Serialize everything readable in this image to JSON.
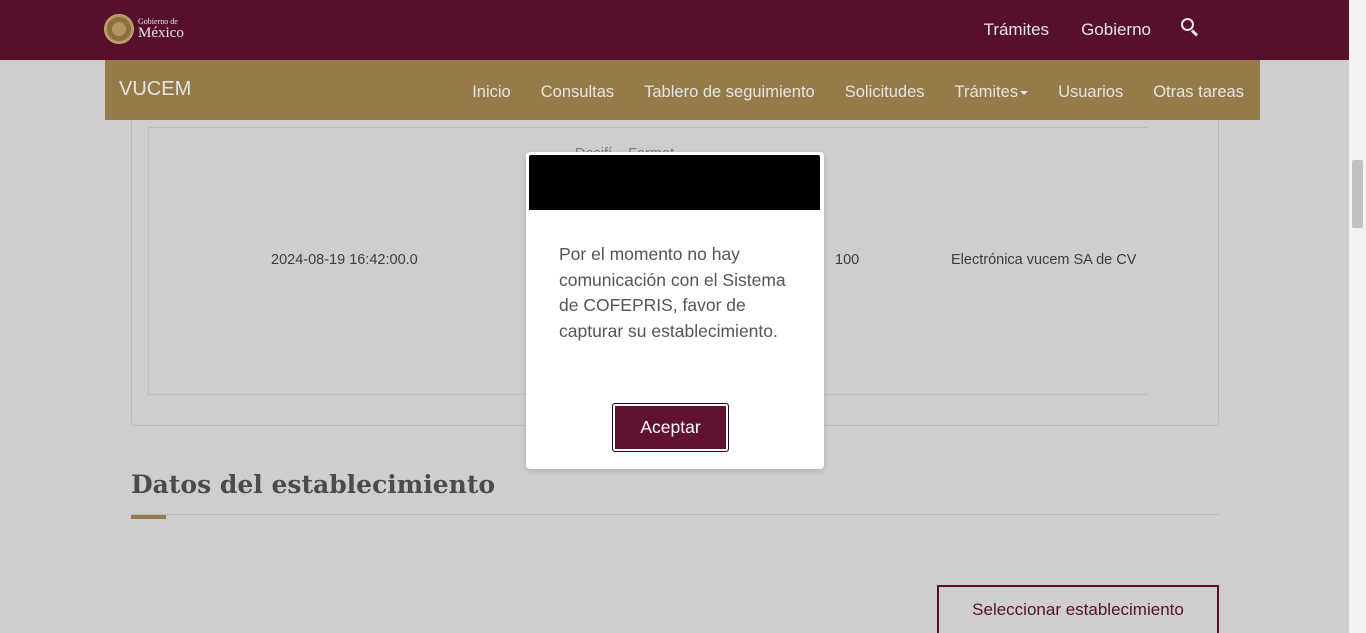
{
  "gov_header": {
    "logo_small": "Gobierno de",
    "logo_big": "México",
    "nav": [
      "Trámites",
      "Gobierno"
    ]
  },
  "vucem_nav": {
    "title": "VUCEM",
    "items": [
      "Inicio",
      "Consultas",
      "Tablero de seguimiento",
      "Solicitudes",
      "Trámites",
      "Usuarios",
      "Otras tareas"
    ]
  },
  "table": {
    "row": {
      "date": "2024-08-19 16:42:00.0",
      "partial_text": "Dosifí... Farmat...",
      "qty": "100",
      "company": "Electrónica vucem SA de CV"
    }
  },
  "section": {
    "title": "Datos del establecimiento",
    "select_button": "Seleccionar establecimiento"
  },
  "modal": {
    "message": "Por el momento no hay comunicación con el Sistema de COFEPRIS, favor de capturar su establecimiento.",
    "accept": "Aceptar"
  },
  "colors": {
    "gov_primary": "#611232",
    "gov_gold": "#a68a52"
  }
}
